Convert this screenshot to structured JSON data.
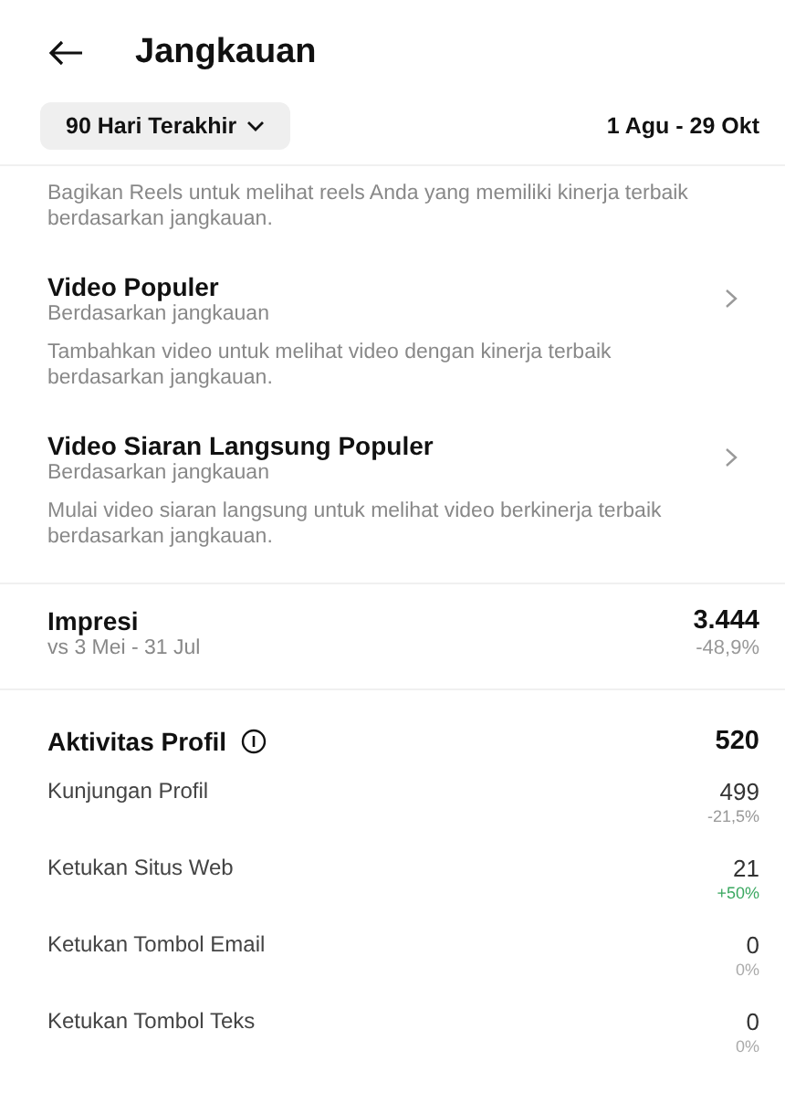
{
  "header": {
    "title": "Jangkauan"
  },
  "filter": {
    "range": "90 Hari Terakhir",
    "dates": "1 Agu - 29 Okt"
  },
  "intro": "Bagikan Reels untuk melihat reels Anda yang memiliki kinerja terbaik berdasarkan jangkauan.",
  "sections": [
    {
      "title": "Video Populer",
      "subtitle": "Berdasarkan jangkauan",
      "description": "Tambahkan video untuk melihat video dengan kinerja terbaik berdasarkan jangkauan."
    },
    {
      "title": "Video Siaran Langsung Populer",
      "subtitle": "Berdasarkan jangkauan",
      "description": "Mulai video siaran langsung untuk melihat video berkinerja terbaik berdasarkan jangkauan."
    }
  ],
  "impressions": {
    "label": "Impresi",
    "comparison": "vs 3 Mei - 31 Jul",
    "value": "3.444",
    "change": "-48,9%"
  },
  "profile_activity": {
    "title": "Aktivitas Profil",
    "total": "520",
    "rows": [
      {
        "label": "Kunjungan Profil",
        "value": "499",
        "change": "-21,5%",
        "color": "#999999"
      },
      {
        "label": "Ketukan Situs Web",
        "value": "21",
        "change": "+50%",
        "color": "#3aa860"
      },
      {
        "label": "Ketukan Tombol Email",
        "value": "0",
        "change": "0%",
        "color": "#aaaaaa"
      },
      {
        "label": "Ketukan Tombol Teks",
        "value": "0",
        "change": "0%",
        "color": "#aaaaaa"
      }
    ]
  }
}
